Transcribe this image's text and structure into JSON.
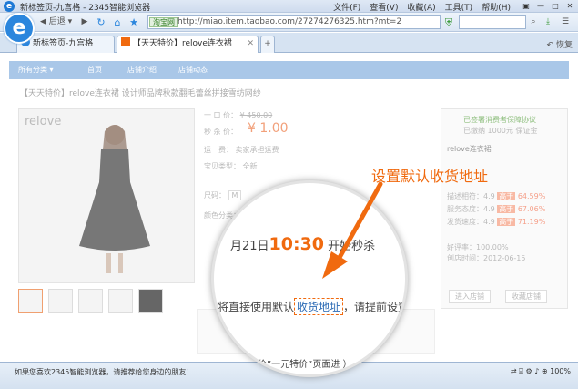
{
  "window": {
    "title": "新标签页-九宫格 - 2345智能浏览器",
    "menu": [
      "文件(F)",
      "查看(V)",
      "收藏(A)",
      "工具(T)",
      "帮助(H)"
    ]
  },
  "nav": {
    "back_label": "后退",
    "address_tag": "淘宝网",
    "url": "http://miao.item.taobao.com/27274276325.htm?mt=2"
  },
  "tabs": [
    {
      "label": "新标签页-九宫格"
    },
    {
      "label": "【天天特价】relove连衣裙"
    }
  ],
  "restore_label": "恢复",
  "shop": {
    "nav_items": [
      "所有分类 ▾",
      "首页",
      "店铺介绍",
      "店铺动态"
    ],
    "product_title": "【天天特价】relove连衣裙 设计师品牌秋款翻毛蕾丝拼接雪纺网纱",
    "brand": "relove",
    "original_price_label": "一 口 价：",
    "original_price": "¥ 450.00",
    "sale_label": "秒 杀 价：",
    "sale_price": "¥ 1.00",
    "freight_label": "运　费：",
    "freight_value": "卖家承担运费",
    "type_label": "宝贝类型：",
    "type_value": "全新",
    "size_label": "尺码：",
    "size_value": "M",
    "color_label": "颜色分类：",
    "guarantee_title": "已签署消费者保障协议",
    "guarantee_sub": "已缴纳 1000元 保证金",
    "shop_brand": "relove连衣裙",
    "ratings": [
      {
        "label": "描述相符：4.9",
        "badge": "高于",
        "value": "64.59%"
      },
      {
        "label": "服务态度：4.9",
        "badge": "高于",
        "value": "67.06%"
      },
      {
        "label": "发货速度：4.9",
        "badge": "高于",
        "value": "71.19%"
      }
    ],
    "praise": "好评率：100.00%",
    "since": "创店时间：2012-06-15",
    "enter_shop": "进入店铺",
    "fav_shop": "收藏店铺"
  },
  "magnifier": {
    "date_prefix": "月21日",
    "time": "10:30",
    "date_suffix": "开始秒杀",
    "text_before": "将直接使用默认",
    "address_link": "收货地址",
    "text_after": "，请提前设置正",
    "footer": "价”一元特价”页面进 ）"
  },
  "callout": {
    "text": "设置默认收货地址",
    "color": "#f06a0f"
  },
  "status": {
    "message": "如果您喜欢2345智能浏览器，请推荐给您身边的朋友！",
    "zoom": "100%"
  }
}
